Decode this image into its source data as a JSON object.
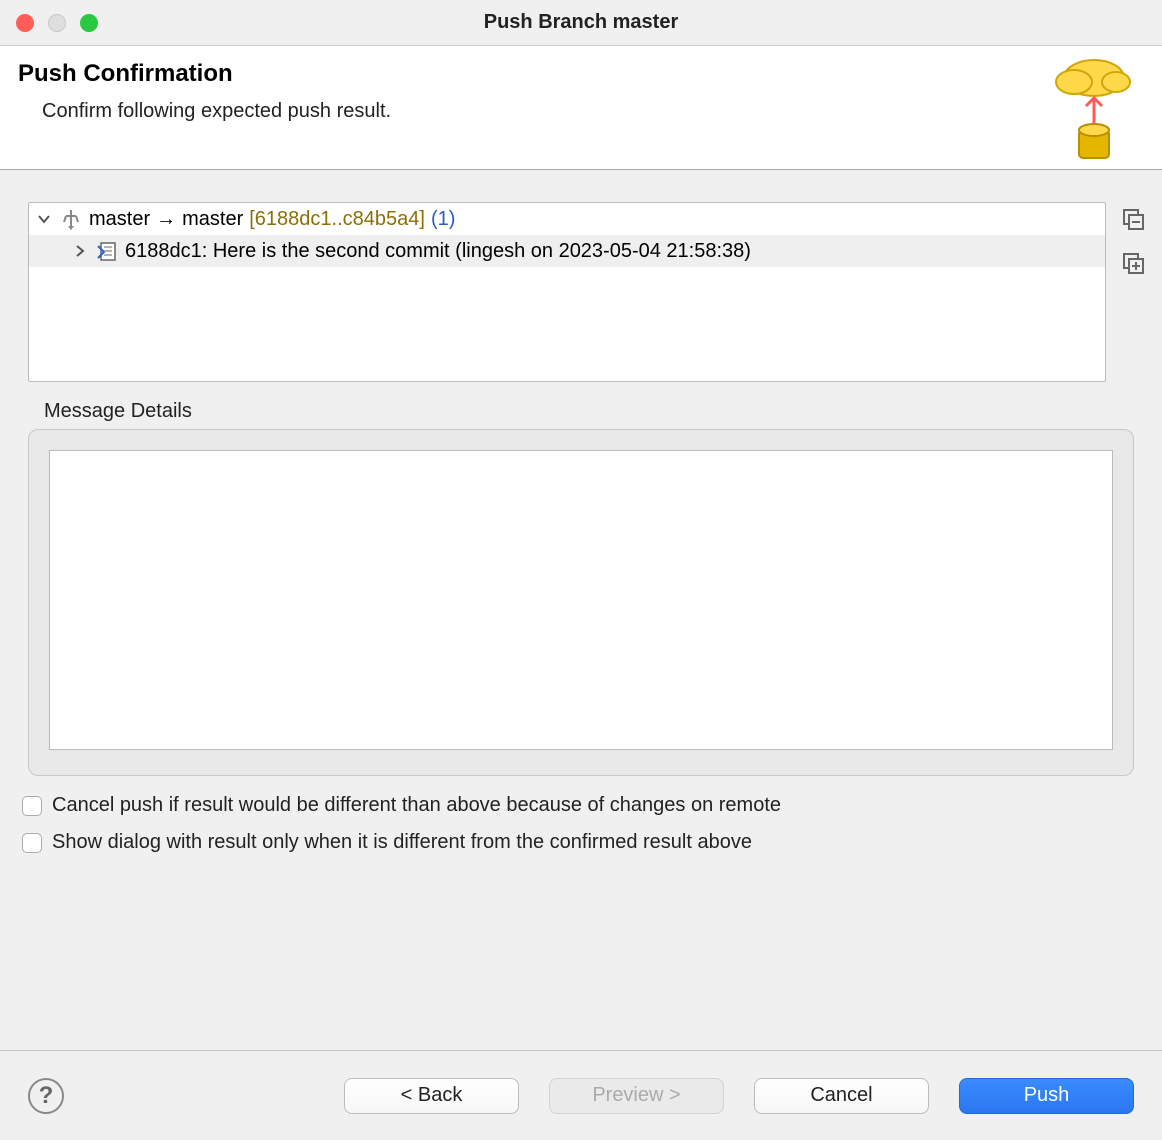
{
  "window": {
    "title": "Push Branch master"
  },
  "header": {
    "title": "Push Confirmation",
    "subtitle": "Confirm following expected push result."
  },
  "tree": {
    "root": {
      "local_branch": "master",
      "arrow": "→",
      "remote_branch": "master",
      "sha_range": "[6188dc1..c84b5a4]",
      "count": "(1)"
    },
    "commit": {
      "text": "6188dc1: Here is the second commit (lingesh on 2023-05-04 21:58:38)"
    }
  },
  "message_details": {
    "label": "Message Details",
    "value": ""
  },
  "options": {
    "cancel_push": "Cancel push if result would be different than above because of changes on remote",
    "show_dialog": "Show dialog with result only when it is different from the confirmed result above"
  },
  "footer": {
    "back": "< Back",
    "preview": "Preview >",
    "cancel": "Cancel",
    "push": "Push"
  }
}
